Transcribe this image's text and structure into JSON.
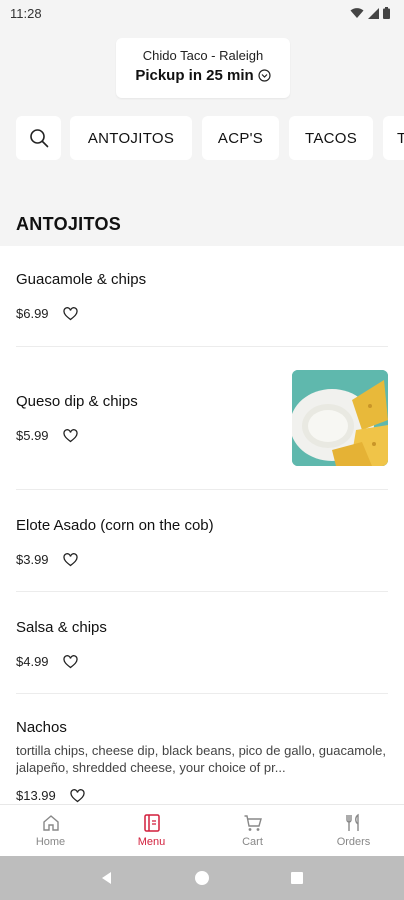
{
  "status_bar": {
    "time": "11:28"
  },
  "location": {
    "name": "Chido Taco - Raleigh",
    "pickup": "Pickup in 25 min"
  },
  "categories": [
    "ANTOJITOS",
    "ACP'S",
    "TACOS",
    "T"
  ],
  "section": {
    "title": "ANTOJITOS"
  },
  "menu_items": [
    {
      "name": "Guacamole & chips",
      "price": "$6.99"
    },
    {
      "name": "Queso dip & chips",
      "price": "$5.99"
    },
    {
      "name": "Elote Asado (corn on the cob)",
      "price": "$3.99"
    },
    {
      "name": "Salsa & chips",
      "price": "$4.99"
    },
    {
      "name": "Nachos",
      "description": "tortilla chips, cheese dip, black beans, pico de gallo, guacamole, jalapeño, shredded cheese, your choice of pr...",
      "price": "$13.99"
    }
  ],
  "bottom_nav": [
    {
      "label": "Home"
    },
    {
      "label": "Menu"
    },
    {
      "label": "Cart"
    },
    {
      "label": "Orders"
    }
  ],
  "colors": {
    "accent": "#d21f3c",
    "background": "#f4f4f4"
  }
}
